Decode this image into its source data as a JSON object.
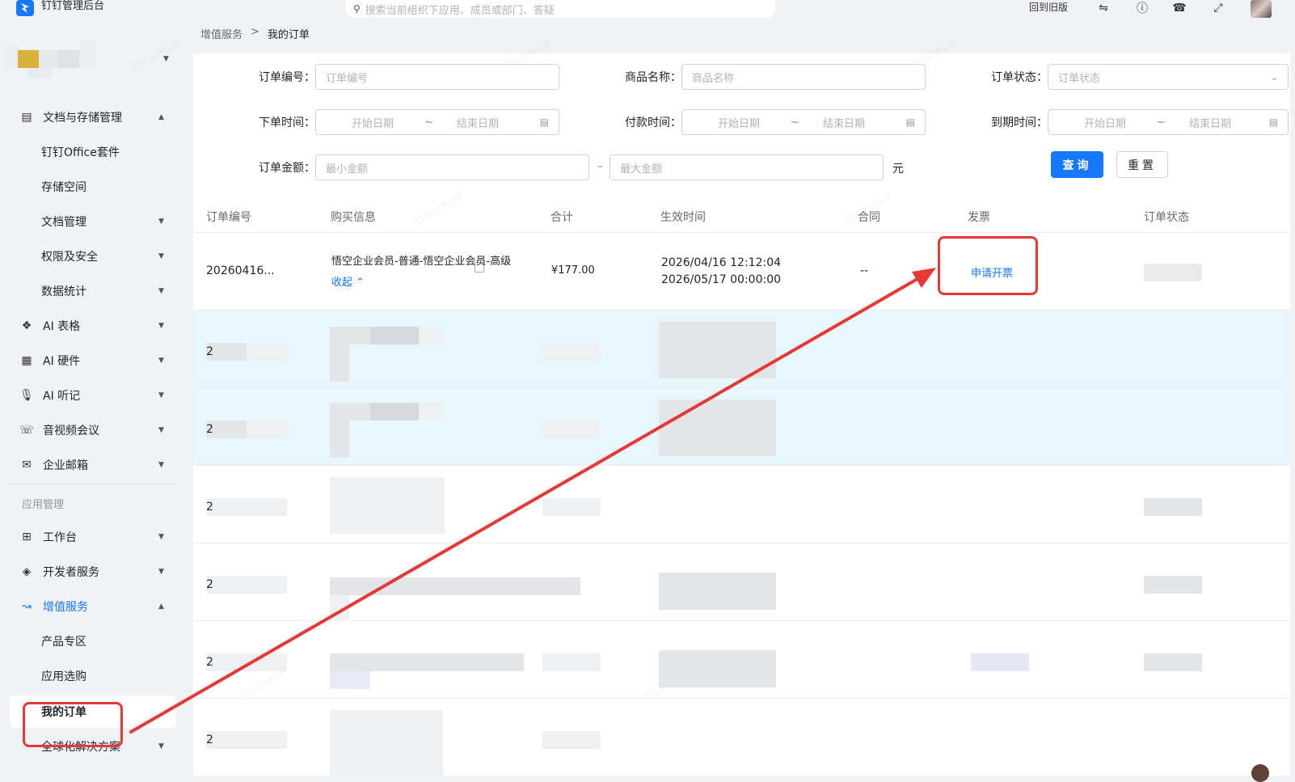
{
  "topbar": {
    "app_title": "钉钉管理后台",
    "search_placeholder": "搜索当前组织下应用、成员或部门、答疑",
    "back_old": "回到旧版"
  },
  "breadcrumb": {
    "parent": "增值服务",
    "sep": ">",
    "current": "我的订单"
  },
  "sidebar": {
    "items": [
      {
        "label": "文档与存储管理"
      },
      {
        "label": "钉钉Office套件"
      },
      {
        "label": "存储空间"
      },
      {
        "label": "文档管理"
      },
      {
        "label": "权限及安全"
      },
      {
        "label": "数据统计"
      },
      {
        "label": "AI 表格"
      },
      {
        "label": "AI 硬件"
      },
      {
        "label": "AI 听记"
      },
      {
        "label": "音视频会议"
      },
      {
        "label": "企业邮箱"
      },
      {
        "label": "工作台"
      },
      {
        "label": "开发者服务"
      },
      {
        "label": "增值服务"
      },
      {
        "label": "产品专区"
      },
      {
        "label": "应用选购"
      },
      {
        "label": "我的订单"
      },
      {
        "label": "全球化解决方案"
      }
    ],
    "group_app": "应用管理"
  },
  "filters": {
    "order_no_label": "订单编号：",
    "order_no_placeholder": "订单编号",
    "product_label": "商品名称：",
    "product_placeholder": "商品名称",
    "status_label": "订单状态：",
    "status_placeholder": "订单状态",
    "order_time_label": "下单时间：",
    "pay_time_label": "付款时间：",
    "expire_time_label": "到期时间：",
    "start_date": "开始日期",
    "end_date": "结束日期",
    "tilde": "~",
    "amount_label": "订单金额：",
    "min_amount": "最小金额",
    "max_amount": "最大金额",
    "dash": "–",
    "unit": "元",
    "query": "查询",
    "reset": "重置"
  },
  "table": {
    "headers": [
      "订单编号",
      "购买信息",
      "合计",
      "生效时间",
      "合同",
      "发票",
      "订单状态"
    ],
    "row1": {
      "order_no": "20260416...",
      "purchase": "悟空企业会员-普通-悟空企业会员-高级",
      "collapse": "收起",
      "total": "¥177.00",
      "start": "2026/04/16 12:12:04",
      "end": "2026/05/17 00:00:00",
      "contract": "--",
      "invoice": "申请开票"
    },
    "blurred_prefix": "2"
  },
  "colors": {
    "primary": "#1677ff",
    "annotation": "#e53935",
    "highlight_row": "#e8f6fd"
  },
  "watermark": "钉钉合作伙伴"
}
